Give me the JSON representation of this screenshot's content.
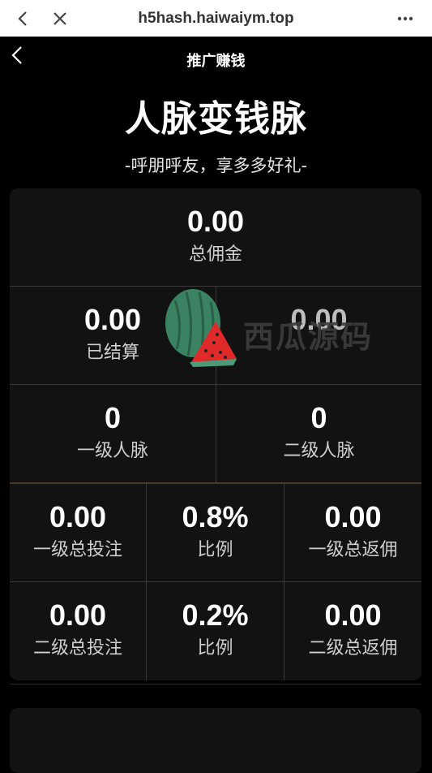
{
  "browser": {
    "url": "h5hash.haiwaiym.top"
  },
  "header": {
    "title": "推广赚钱"
  },
  "hero": {
    "title": "人脉变钱脉",
    "subtitle": "-呼朋呼友，享多多好礼-"
  },
  "stats": {
    "total": {
      "value": "0.00",
      "label": "总佣金"
    },
    "settled": {
      "value": "0.00",
      "label": "已结算"
    },
    "unsettled": {
      "value": "0.00"
    },
    "level1_people": {
      "value": "0",
      "label": "一级人脉"
    },
    "level2_people": {
      "value": "0",
      "label": "二级人脉"
    },
    "level1_bet": {
      "value": "0.00",
      "label": "一级总投注"
    },
    "level1_ratio": {
      "value": "0.8%",
      "label": "比例"
    },
    "level1_rebate": {
      "value": "0.00",
      "label": "一级总返佣"
    },
    "level2_bet": {
      "value": "0.00",
      "label": "二级总投注"
    },
    "level2_ratio": {
      "value": "0.2%",
      "label": "比例"
    },
    "level2_rebate": {
      "value": "0.00",
      "label": "二级总返佣"
    }
  },
  "watermark": {
    "text": "西瓜源码"
  }
}
